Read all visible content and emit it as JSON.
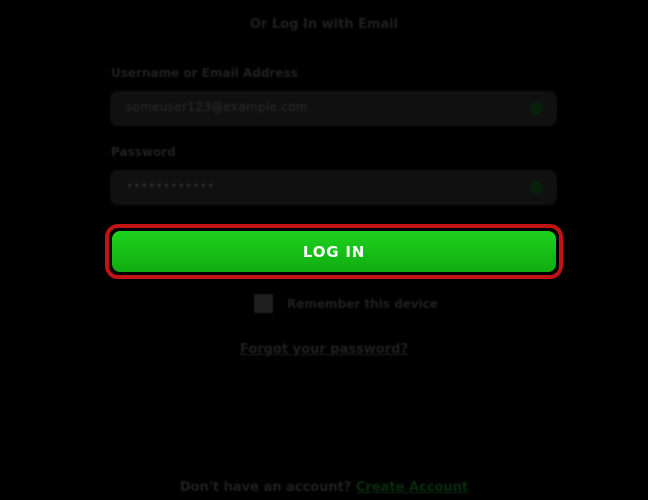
{
  "login": {
    "heading": "Or Log In with Email",
    "username": {
      "label": "Username or Email Address",
      "value": "someuser123@example.com"
    },
    "password": {
      "label": "Password",
      "value": "••••••••••••"
    },
    "submit_label": "LOG IN",
    "remember_label": "Remember this device",
    "forgot_label": "Forgot your password?",
    "signup_prompt": "Don't have an account?",
    "signup_link": "Create Account"
  },
  "colors": {
    "background": "#000000",
    "login_button": "#14be14",
    "highlight_outline": "#c11313"
  }
}
